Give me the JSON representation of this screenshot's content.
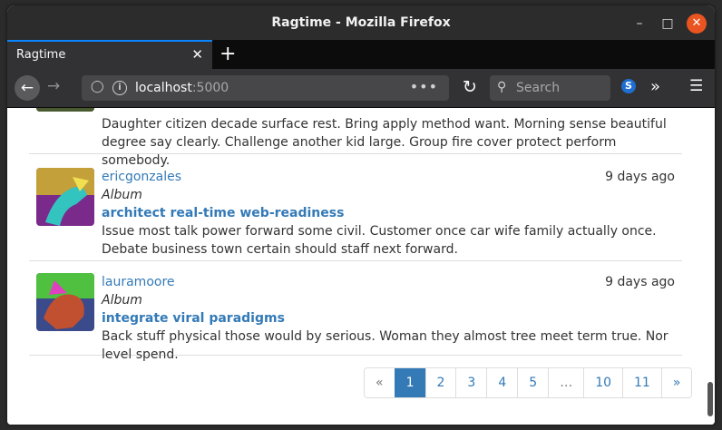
{
  "window": {
    "title": "Ragtime - Mozilla Firefox"
  },
  "tab": {
    "label": "Ragtime",
    "close": "✕"
  },
  "toolbar": {
    "url_host": "localhost",
    "url_port": ":5000",
    "search_placeholder": "Search",
    "page_actions": "•••"
  },
  "posts": [
    {
      "author": "",
      "time": "",
      "type": "",
      "title": "",
      "body": "Daughter citizen decade surface rest. Bring apply method want. Morning sense beautiful degree say clearly. Challenge another kid large. Group fire cover protect perform somebody."
    },
    {
      "author": "ericgonzales",
      "time": "9 days ago",
      "type": "Album",
      "title": "architect real-time web-readiness",
      "body": "Issue most talk power forward some civil. Customer once car wife family actually once. Debate business town certain should staff next forward."
    },
    {
      "author": "lauramoore",
      "time": "9 days ago",
      "type": "Album",
      "title": "integrate viral paradigms",
      "body": "Back stuff physical those would by serious. Woman they almost tree meet term true. Nor level spend."
    }
  ],
  "pagination": {
    "prev": "«",
    "pages": [
      "1",
      "2",
      "3",
      "4",
      "5",
      "…",
      "10",
      "11"
    ],
    "next": "»",
    "active": "1"
  },
  "colors": {
    "link": "#337ab7",
    "accent_tab": "#0a84ff",
    "close_button": "#e95420"
  }
}
